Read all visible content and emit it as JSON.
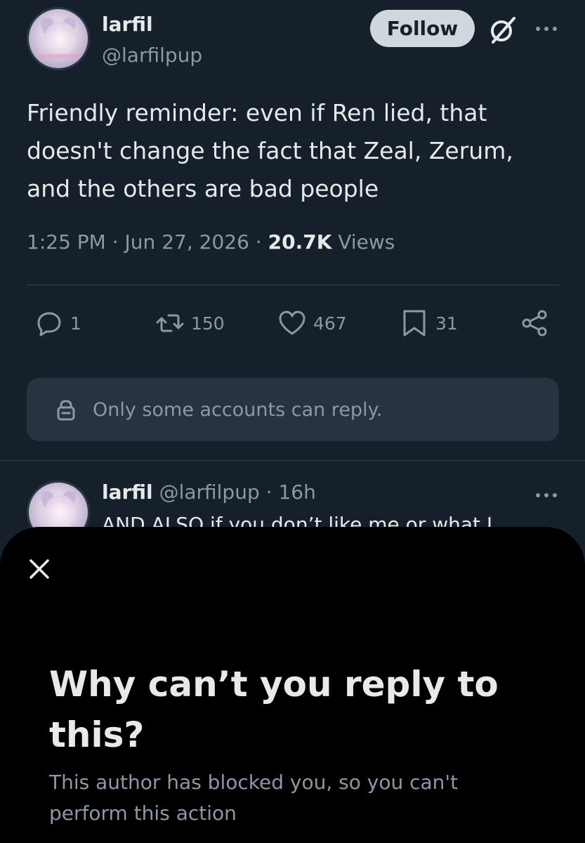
{
  "post": {
    "author": {
      "display_name": "larfil",
      "handle": "@larfilpup"
    },
    "follow_label": "Follow",
    "text": "Friendly reminder: even if Ren lied, that doesn't change the fact that Zeal, Zerum, and the others are bad people",
    "time": "1:25 PM",
    "date": "Jun 27, 2026",
    "views_count": "20.7K",
    "views_label": "Views",
    "separator": "·",
    "actions": {
      "replies": "1",
      "reposts": "150",
      "likes": "467",
      "bookmarks": "31"
    },
    "reply_restriction": "Only some accounts can reply."
  },
  "reply": {
    "display_name": "larfil",
    "handle": "@larfilpup",
    "age": "· 16h",
    "text": "AND ALSO if you don’t like me or what I"
  },
  "sheet": {
    "title": "Why can’t you reply to this?",
    "body": "This author has blocked you, so you can't perform this action"
  },
  "colors": {
    "background": "#15202b",
    "sheet_background": "#000000",
    "primary_text": "#e7e9ea",
    "secondary_text": "#8b98a5",
    "follow_button": "#d0d8de"
  },
  "icons": [
    "grok-icon",
    "more-icon",
    "reply-icon",
    "repost-icon",
    "like-icon",
    "bookmark-icon",
    "share-icon",
    "lock-icon",
    "close-icon"
  ]
}
